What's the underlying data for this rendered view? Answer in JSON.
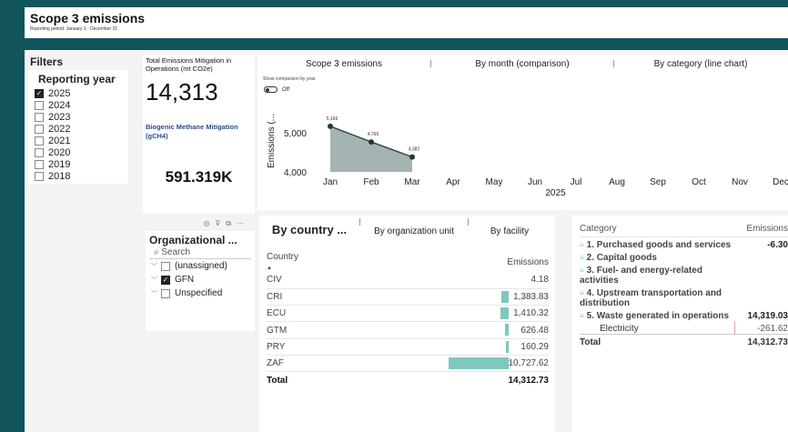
{
  "header": {
    "title": "Scope 3 emissions",
    "subtitle": "Reporting period: January 1 - December 31"
  },
  "filters": {
    "title": "Filters",
    "reporting_year_label": "Reporting year",
    "years": [
      {
        "label": "2025",
        "checked": true
      },
      {
        "label": "2024",
        "checked": false
      },
      {
        "label": "2023",
        "checked": false
      },
      {
        "label": "2022",
        "checked": false
      },
      {
        "label": "2021",
        "checked": false
      },
      {
        "label": "2020",
        "checked": false
      },
      {
        "label": "2019",
        "checked": false
      },
      {
        "label": "2018",
        "checked": false
      }
    ]
  },
  "cards": {
    "total_label": "Total Emissions Mitigation in Operations (mt CO2e)",
    "total_value": "14,313",
    "methane_label": "Biogenic Methane Mitigation (gCH4)",
    "methane_value": "591.319K"
  },
  "chart_tabs": [
    "Scope 3 emissions",
    "By month (comparison)",
    "By category (line chart)"
  ],
  "comparison_toggle": {
    "label": "Show comparison by year",
    "state": "Off"
  },
  "chart_data": {
    "type": "area",
    "x": [
      "Jan",
      "Feb",
      "Mar",
      "Apr",
      "May",
      "Jun",
      "Jul",
      "Aug",
      "Sep",
      "Oct",
      "Nov",
      "Dec"
    ],
    "values": [
      5166,
      4765,
      4382,
      null,
      null,
      null,
      null,
      null,
      null,
      null,
      null,
      null
    ],
    "data_labels": [
      "5,166",
      "4,765",
      "4,382"
    ],
    "ylabel": "Emissions (...",
    "xlabel": "2025",
    "yticks": [
      "5,000",
      "4,000"
    ],
    "ylim": [
      4000,
      5300
    ],
    "color": "#a3b4b2"
  },
  "org_slicer": {
    "title": "Organizational ...",
    "search_placeholder": "Search",
    "items": [
      {
        "label": "(unassigned)",
        "checked": false
      },
      {
        "label": "GFN",
        "checked": true
      },
      {
        "label": "Unspecified",
        "checked": false
      }
    ]
  },
  "country_tabs": [
    "By country ...",
    "By organization unit",
    "By facility"
  ],
  "country_table": {
    "headers": [
      "Country",
      "Emissions"
    ],
    "rows": [
      {
        "country": "CIV",
        "value": 4.18,
        "display": "4.18"
      },
      {
        "country": "CRI",
        "value": 1383.83,
        "display": "1,383.83"
      },
      {
        "country": "ECU",
        "value": 1410.32,
        "display": "1,410.32"
      },
      {
        "country": "GTM",
        "value": 626.48,
        "display": "626.48"
      },
      {
        "country": "PRY",
        "value": 160.29,
        "display": "160.29"
      },
      {
        "country": "ZAF",
        "value": 10727.62,
        "display": "10,727.62"
      }
    ],
    "total_label": "Total",
    "total_value": "14,312.73",
    "bar_color": "#7ec8c0"
  },
  "category_table": {
    "headers": [
      "Category",
      "Emissions"
    ],
    "rows": [
      {
        "name": "1. Purchased goods and services",
        "value": "-6.30",
        "bold": true
      },
      {
        "name": "2. Capital goods",
        "value": "",
        "bold": true
      },
      {
        "name": "3. Fuel- and energy-related activities",
        "value": "",
        "bold": true
      },
      {
        "name": "4. Upstream transportation and distribution",
        "value": "",
        "bold": true
      },
      {
        "name": "5. Waste generated in operations",
        "value": "14,319.03",
        "bold": true
      },
      {
        "name": "Electricity",
        "value": "-261.62",
        "bold": false
      }
    ],
    "total_label": "Total",
    "total_value": "14,312.73"
  }
}
